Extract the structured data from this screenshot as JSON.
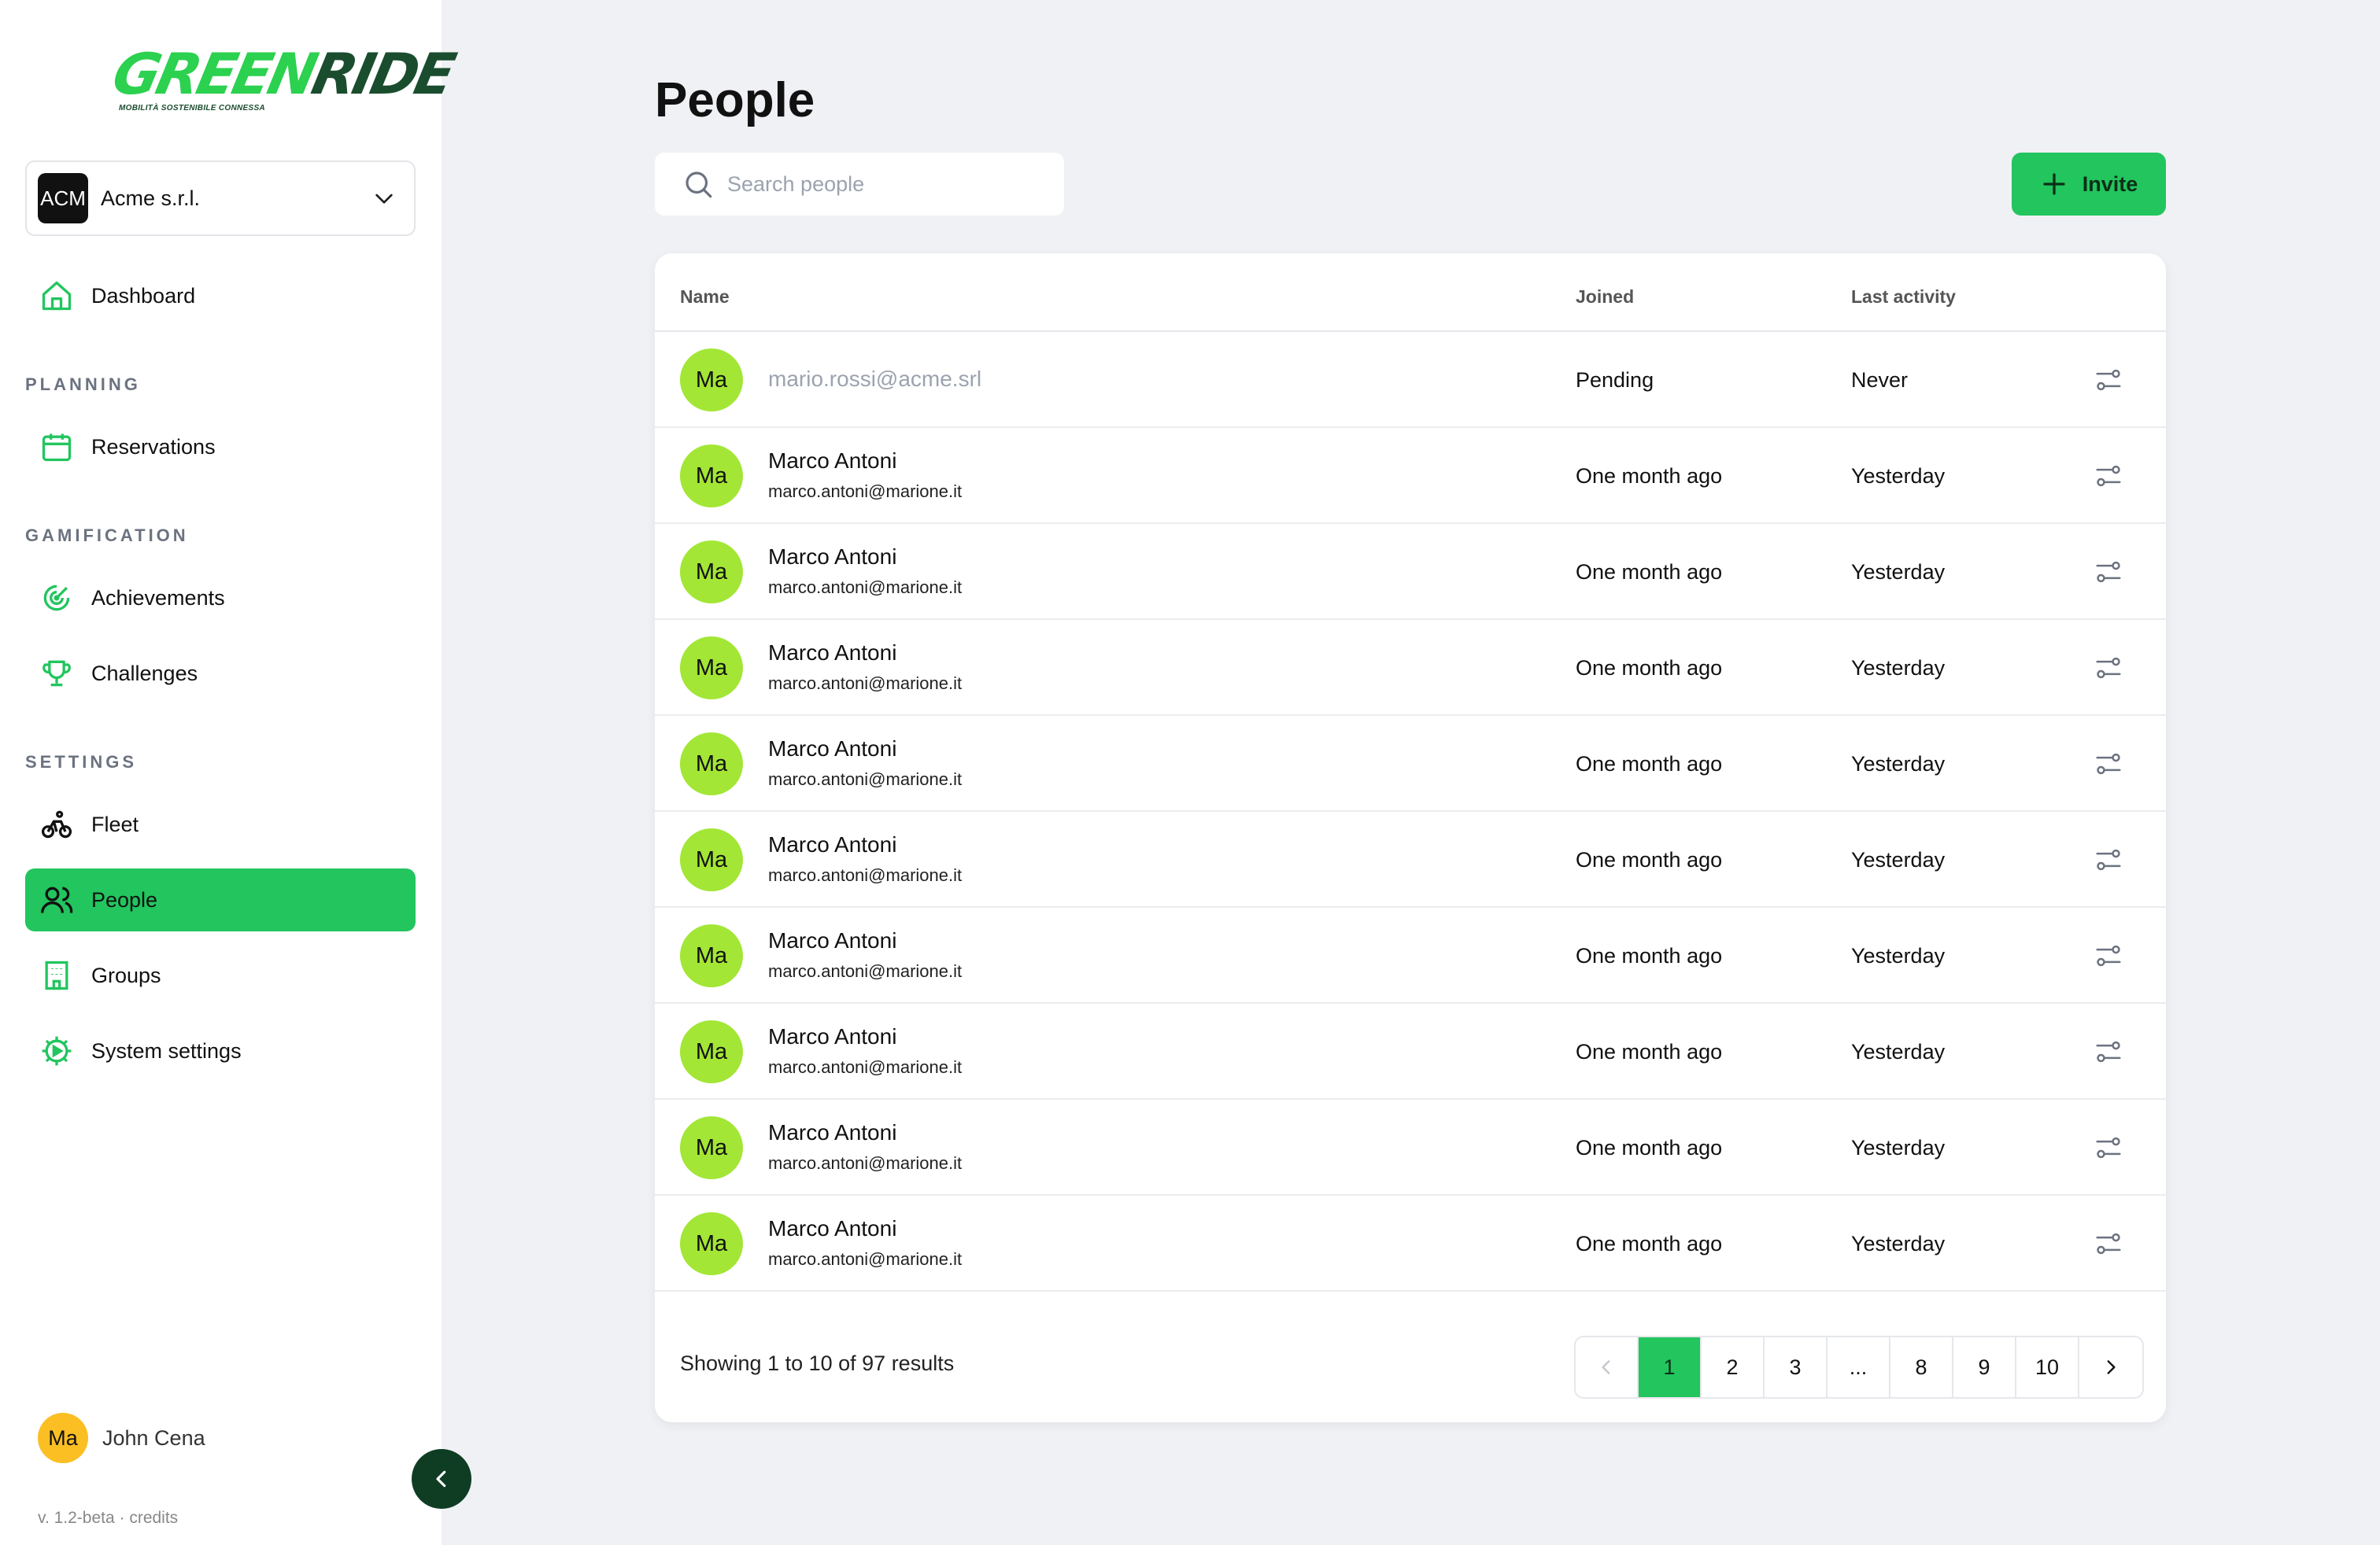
{
  "brand": {
    "logo_part1": "GREEN",
    "logo_part2": "RIDE",
    "tagline": "MOBILITÀ SOSTENIBILE CONNESSA",
    "accent": "#22c55e",
    "dark": "#0f3d24"
  },
  "org": {
    "initials": "ACM",
    "name": "Acme s.r.l."
  },
  "sidebar": {
    "dashboard": "Dashboard",
    "sections": {
      "planning": "PLANNING",
      "gamification": "GAMIFICATION",
      "settings": "SETTINGS"
    },
    "items": {
      "reservations": "Reservations",
      "achievements": "Achievements",
      "challenges": "Challenges",
      "fleet": "Fleet",
      "people": "People",
      "groups": "Groups",
      "system_settings": "System settings"
    },
    "active": "people"
  },
  "user": {
    "initials": "Ma",
    "name": "John Cena"
  },
  "version": "v. 1.2-beta · credits",
  "page": {
    "title": "People",
    "search_placeholder": "Search people",
    "invite_label": "Invite"
  },
  "table": {
    "columns": {
      "name": "Name",
      "joined": "Joined",
      "last_activity": "Last activity"
    },
    "rows": [
      {
        "initials": "Ma",
        "name": "",
        "email": "mario.rossi@acme.srl",
        "joined": "Pending",
        "last_activity": "Never",
        "pending": true
      },
      {
        "initials": "Ma",
        "name": "Marco Antoni",
        "email": "marco.antoni@marione.it",
        "joined": "One month ago",
        "last_activity": "Yesterday"
      },
      {
        "initials": "Ma",
        "name": "Marco Antoni",
        "email": "marco.antoni@marione.it",
        "joined": "One month ago",
        "last_activity": "Yesterday"
      },
      {
        "initials": "Ma",
        "name": "Marco Antoni",
        "email": "marco.antoni@marione.it",
        "joined": "One month ago",
        "last_activity": "Yesterday"
      },
      {
        "initials": "Ma",
        "name": "Marco Antoni",
        "email": "marco.antoni@marione.it",
        "joined": "One month ago",
        "last_activity": "Yesterday"
      },
      {
        "initials": "Ma",
        "name": "Marco Antoni",
        "email": "marco.antoni@marione.it",
        "joined": "One month ago",
        "last_activity": "Yesterday"
      },
      {
        "initials": "Ma",
        "name": "Marco Antoni",
        "email": "marco.antoni@marione.it",
        "joined": "One month ago",
        "last_activity": "Yesterday"
      },
      {
        "initials": "Ma",
        "name": "Marco Antoni",
        "email": "marco.antoni@marione.it",
        "joined": "One month ago",
        "last_activity": "Yesterday"
      },
      {
        "initials": "Ma",
        "name": "Marco Antoni",
        "email": "marco.antoni@marione.it",
        "joined": "One month ago",
        "last_activity": "Yesterday"
      },
      {
        "initials": "Ma",
        "name": "Marco Antoni",
        "email": "marco.antoni@marione.it",
        "joined": "One month ago",
        "last_activity": "Yesterday"
      }
    ]
  },
  "pagination": {
    "summary": "Showing 1 to 10 of 97 results",
    "pages": [
      "1",
      "2",
      "3",
      "...",
      "8",
      "9",
      "10"
    ],
    "current": "1"
  }
}
